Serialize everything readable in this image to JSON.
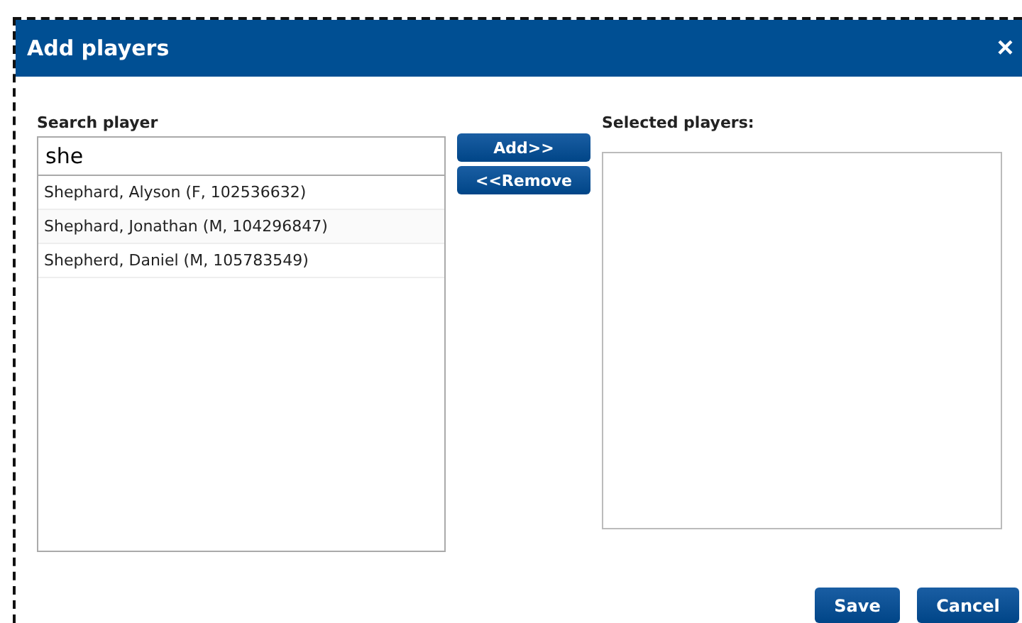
{
  "window": {
    "title": "Add players",
    "close": "×"
  },
  "search": {
    "label": "Search player",
    "value": "she"
  },
  "results": [
    {
      "text": "Shephard, Alyson (F, 102536632)"
    },
    {
      "text": "Shephard, Jonathan (M, 104296847)"
    },
    {
      "text": "Shepherd, Daniel (M, 105783549)"
    }
  ],
  "move_buttons": [
    "Add>>",
    "<<Remove"
  ],
  "selected": {
    "label": "Selected players:"
  },
  "buttons": [
    "Save",
    "Cancel"
  ]
}
